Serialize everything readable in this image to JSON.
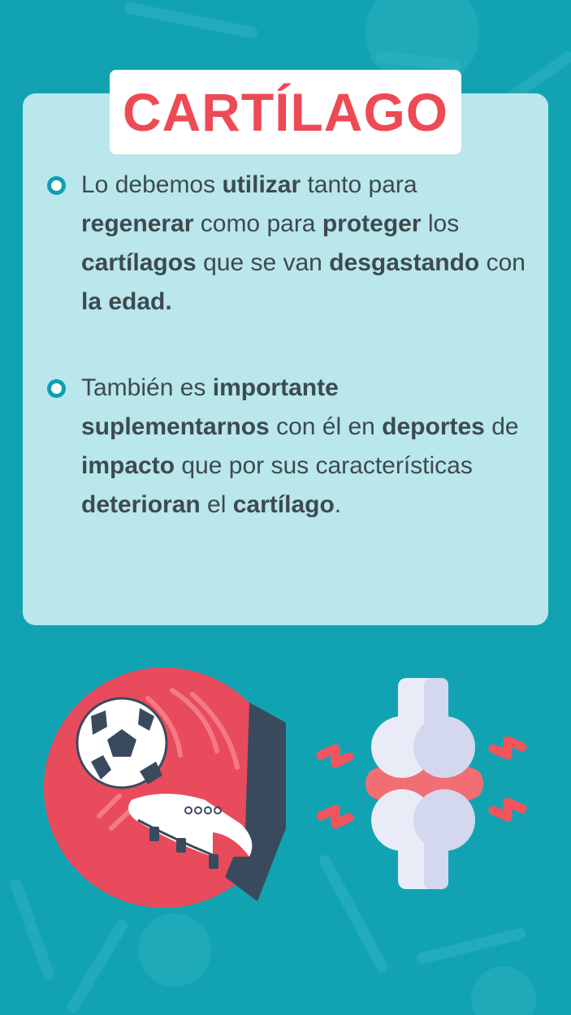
{
  "title": "CARTÍLAGO",
  "bullets": [
    {
      "segments": [
        {
          "text": "Lo debemos ",
          "bold": false
        },
        {
          "text": "utilizar",
          "bold": true
        },
        {
          "text": " tanto para ",
          "bold": false
        },
        {
          "text": "regenerar",
          "bold": true
        },
        {
          "text": " como para ",
          "bold": false
        },
        {
          "text": "proteger",
          "bold": true
        },
        {
          "text": " los ",
          "bold": false
        },
        {
          "text": "cartílagos",
          "bold": true
        },
        {
          "text": " que se van ",
          "bold": false
        },
        {
          "text": "desgastando",
          "bold": true
        },
        {
          "text": " con ",
          "bold": false
        },
        {
          "text": "la edad.",
          "bold": true
        }
      ]
    },
    {
      "segments": [
        {
          "text": "También es ",
          "bold": false
        },
        {
          "text": "importante suplementarnos",
          "bold": true
        },
        {
          "text": " con él en ",
          "bold": false
        },
        {
          "text": "deportes",
          "bold": true
        },
        {
          "text": " de ",
          "bold": false
        },
        {
          "text": "impacto",
          "bold": true
        },
        {
          "text": " que por sus características ",
          "bold": false
        },
        {
          "text": "deterioran",
          "bold": true
        },
        {
          "text": " el ",
          "bold": false
        },
        {
          "text": "cartílago",
          "bold": true
        },
        {
          "text": ".",
          "bold": false
        }
      ]
    }
  ],
  "icons": {
    "bullet": "ring-bullet-icon",
    "left_illustration": "soccer-kick-icon",
    "right_illustration": "knee-joint-pain-icon"
  },
  "colors": {
    "background": "#12a3b3",
    "card": "#d0f0f3",
    "title": "#ee4a55",
    "text": "#3d4a4f",
    "accent": "#0e9fb0"
  }
}
